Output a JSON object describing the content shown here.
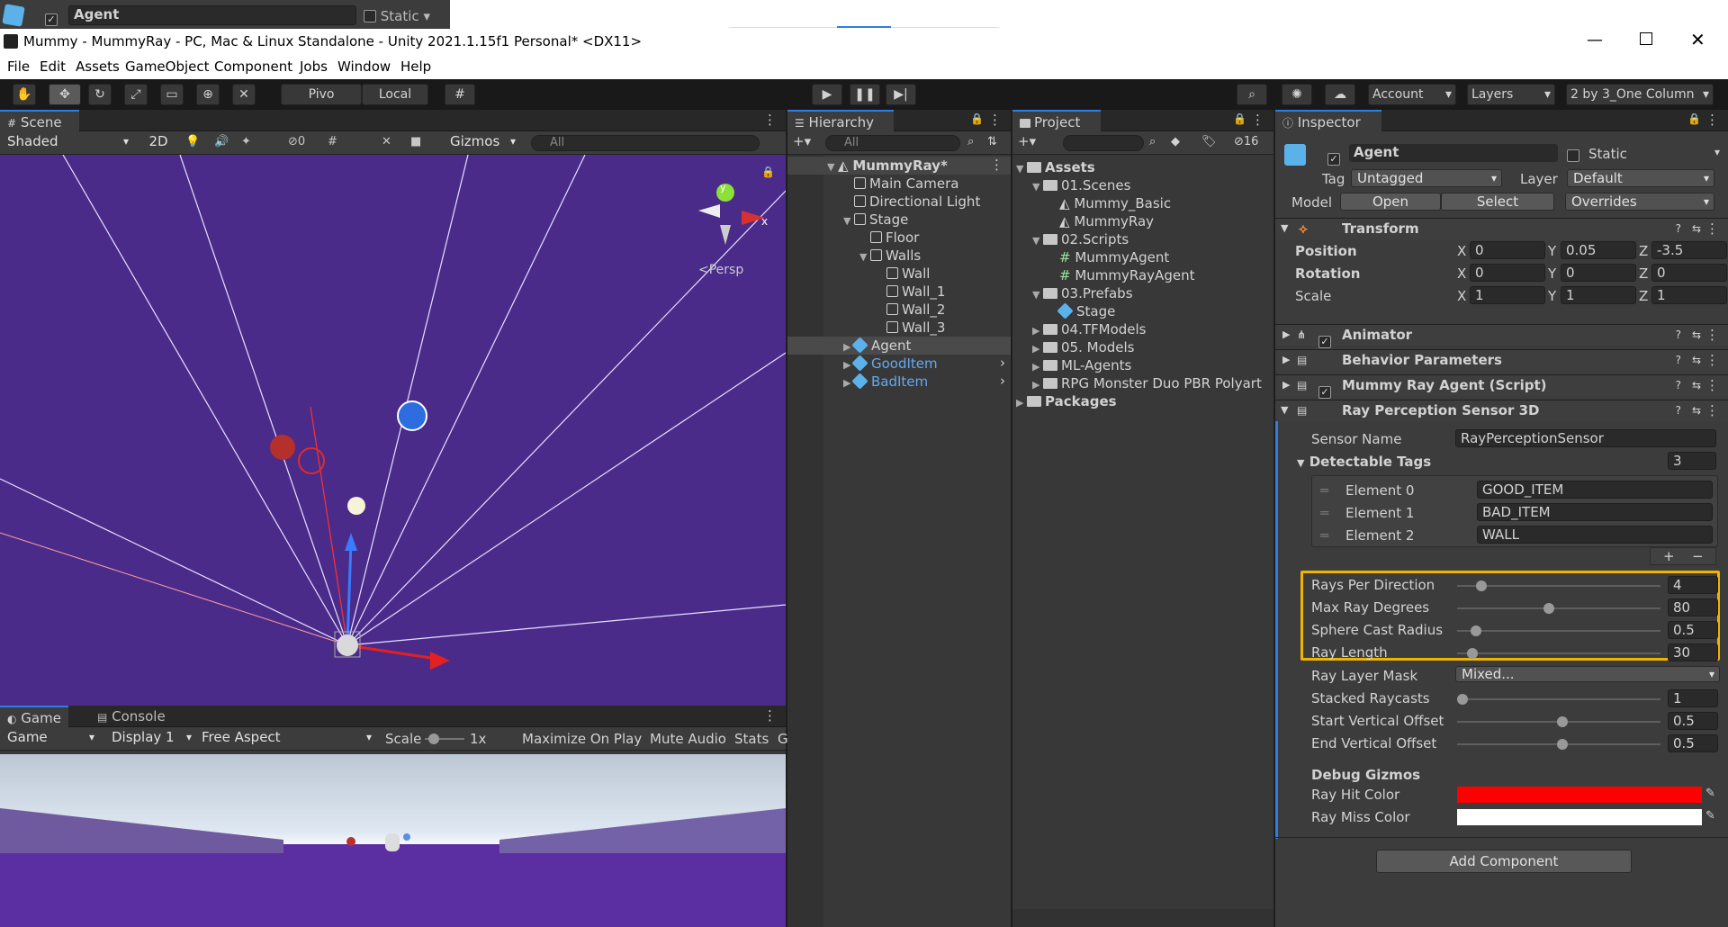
{
  "topbar": {
    "name": "Agent",
    "static_label": "Static"
  },
  "window": {
    "title": "Mummy - MummyRay - PC, Mac & Linux Standalone - Unity 2021.1.15f1 Personal* <DX11>"
  },
  "menu": [
    "File",
    "Edit",
    "Assets",
    "GameObject",
    "Component",
    "Jobs",
    "Window",
    "Help"
  ],
  "toolbar": {
    "pivot": "Pivo",
    "local": "Local",
    "account": "Account",
    "layers": "Layers",
    "layout": "2 by 3_One Column"
  },
  "scene": {
    "tab": "Scene",
    "shading": "Shaded",
    "mode2d": "2D",
    "hidden_count": "0",
    "gizmos": "Gizmos",
    "search_placeholder": "All",
    "persp": "<Persp",
    "gizmo_axis": "x",
    "gizmo_axis_y": "y"
  },
  "game": {
    "tab": "Game",
    "console_tab": "Console",
    "mode": "Game",
    "display": "Display 1",
    "aspect": "Free Aspect",
    "scale_label": "Scale",
    "scale_value": "1x",
    "maximize": "Maximize On Play",
    "mute": "Mute Audio",
    "stats": "Stats",
    "more": "G"
  },
  "hierarchy": {
    "tab": "Hierarchy",
    "search_placeholder": "All",
    "items": [
      {
        "label": "MummyRay*",
        "indent": 0
      },
      {
        "label": "Main Camera",
        "indent": 1
      },
      {
        "label": "Directional Light",
        "indent": 1
      },
      {
        "label": "Stage",
        "indent": 1
      },
      {
        "label": "Floor",
        "indent": 2
      },
      {
        "label": "Walls",
        "indent": 2
      },
      {
        "label": "Wall",
        "indent": 3
      },
      {
        "label": "Wall_1",
        "indent": 3
      },
      {
        "label": "Wall_2",
        "indent": 3
      },
      {
        "label": "Wall_3",
        "indent": 3
      },
      {
        "label": "Agent",
        "indent": 1
      },
      {
        "label": "GoodItem",
        "indent": 1
      },
      {
        "label": "BadItem",
        "indent": 1
      }
    ]
  },
  "project": {
    "tab": "Project",
    "hidden_count": "16",
    "items": [
      {
        "label": "Assets"
      },
      {
        "label": "01.Scenes"
      },
      {
        "label": "Mummy_Basic"
      },
      {
        "label": "MummyRay"
      },
      {
        "label": "02.Scripts"
      },
      {
        "label": "MummyAgent"
      },
      {
        "label": "MummyRayAgent"
      },
      {
        "label": "03.Prefabs"
      },
      {
        "label": "Stage"
      },
      {
        "label": "04.TFModels"
      },
      {
        "label": "05. Models"
      },
      {
        "label": "ML-Agents"
      },
      {
        "label": "RPG Monster Duo PBR Polyart"
      },
      {
        "label": "Packages"
      }
    ]
  },
  "inspector": {
    "tab": "Inspector",
    "name": "Agent",
    "static_label": "Static",
    "tag_label": "Tag",
    "tag_value": "Untagged",
    "layer_label": "Layer",
    "layer_value": "Default",
    "model_label": "Model",
    "open": "Open",
    "select": "Select",
    "overrides": "Overrides",
    "transform": {
      "title": "Transform",
      "position": "Position",
      "rotation": "Rotation",
      "scale": "Scale",
      "pos": [
        "0",
        "0.05",
        "-3.5"
      ],
      "rot": [
        "0",
        "0",
        "0"
      ],
      "scl": [
        "1",
        "1",
        "1"
      ]
    },
    "animator": "Animator",
    "behavior": "Behavior Parameters",
    "script": "Mummy Ray Agent (Script)",
    "ray": {
      "title": "Ray Perception Sensor 3D",
      "sensor_name_label": "Sensor Name",
      "sensor_name": "RayPerceptionSensor",
      "tags_label": "Detectable Tags",
      "tags_count": "3",
      "elements": [
        {
          "label": "Element 0",
          "value": "GOOD_ITEM"
        },
        {
          "label": "Element 1",
          "value": "BAD_ITEM"
        },
        {
          "label": "Element 2",
          "value": "WALL"
        }
      ],
      "sliders": [
        {
          "label": "Rays Per Direction",
          "value": "4",
          "pos": 0.1
        },
        {
          "label": "Max Ray Degrees",
          "value": "80",
          "pos": 0.45
        },
        {
          "label": "Sphere Cast Radius",
          "value": "0.5",
          "pos": 0.07
        },
        {
          "label": "Ray Length",
          "value": "30",
          "pos": 0.05
        }
      ],
      "layer_mask_label": "Ray Layer Mask",
      "layer_mask": "Mixed...",
      "sliders2": [
        {
          "label": "Stacked Raycasts",
          "value": "1",
          "pos": 0.0
        },
        {
          "label": "Start Vertical Offset",
          "value": "0.5",
          "pos": 0.52
        },
        {
          "label": "End Vertical Offset",
          "value": "0.5",
          "pos": 0.52
        }
      ],
      "debug_label": "Debug Gizmos",
      "hit_color_label": "Ray Hit Color",
      "hit_color": "#ff0000",
      "miss_color_label": "Ray Miss Color",
      "miss_color": "#ffffff",
      "plus": "+",
      "minus": "−"
    },
    "add_component": "Add Component"
  },
  "colors": {
    "accent": "#2e7de0",
    "highlight": "#f0b400",
    "sky": "#4a2b8a"
  }
}
